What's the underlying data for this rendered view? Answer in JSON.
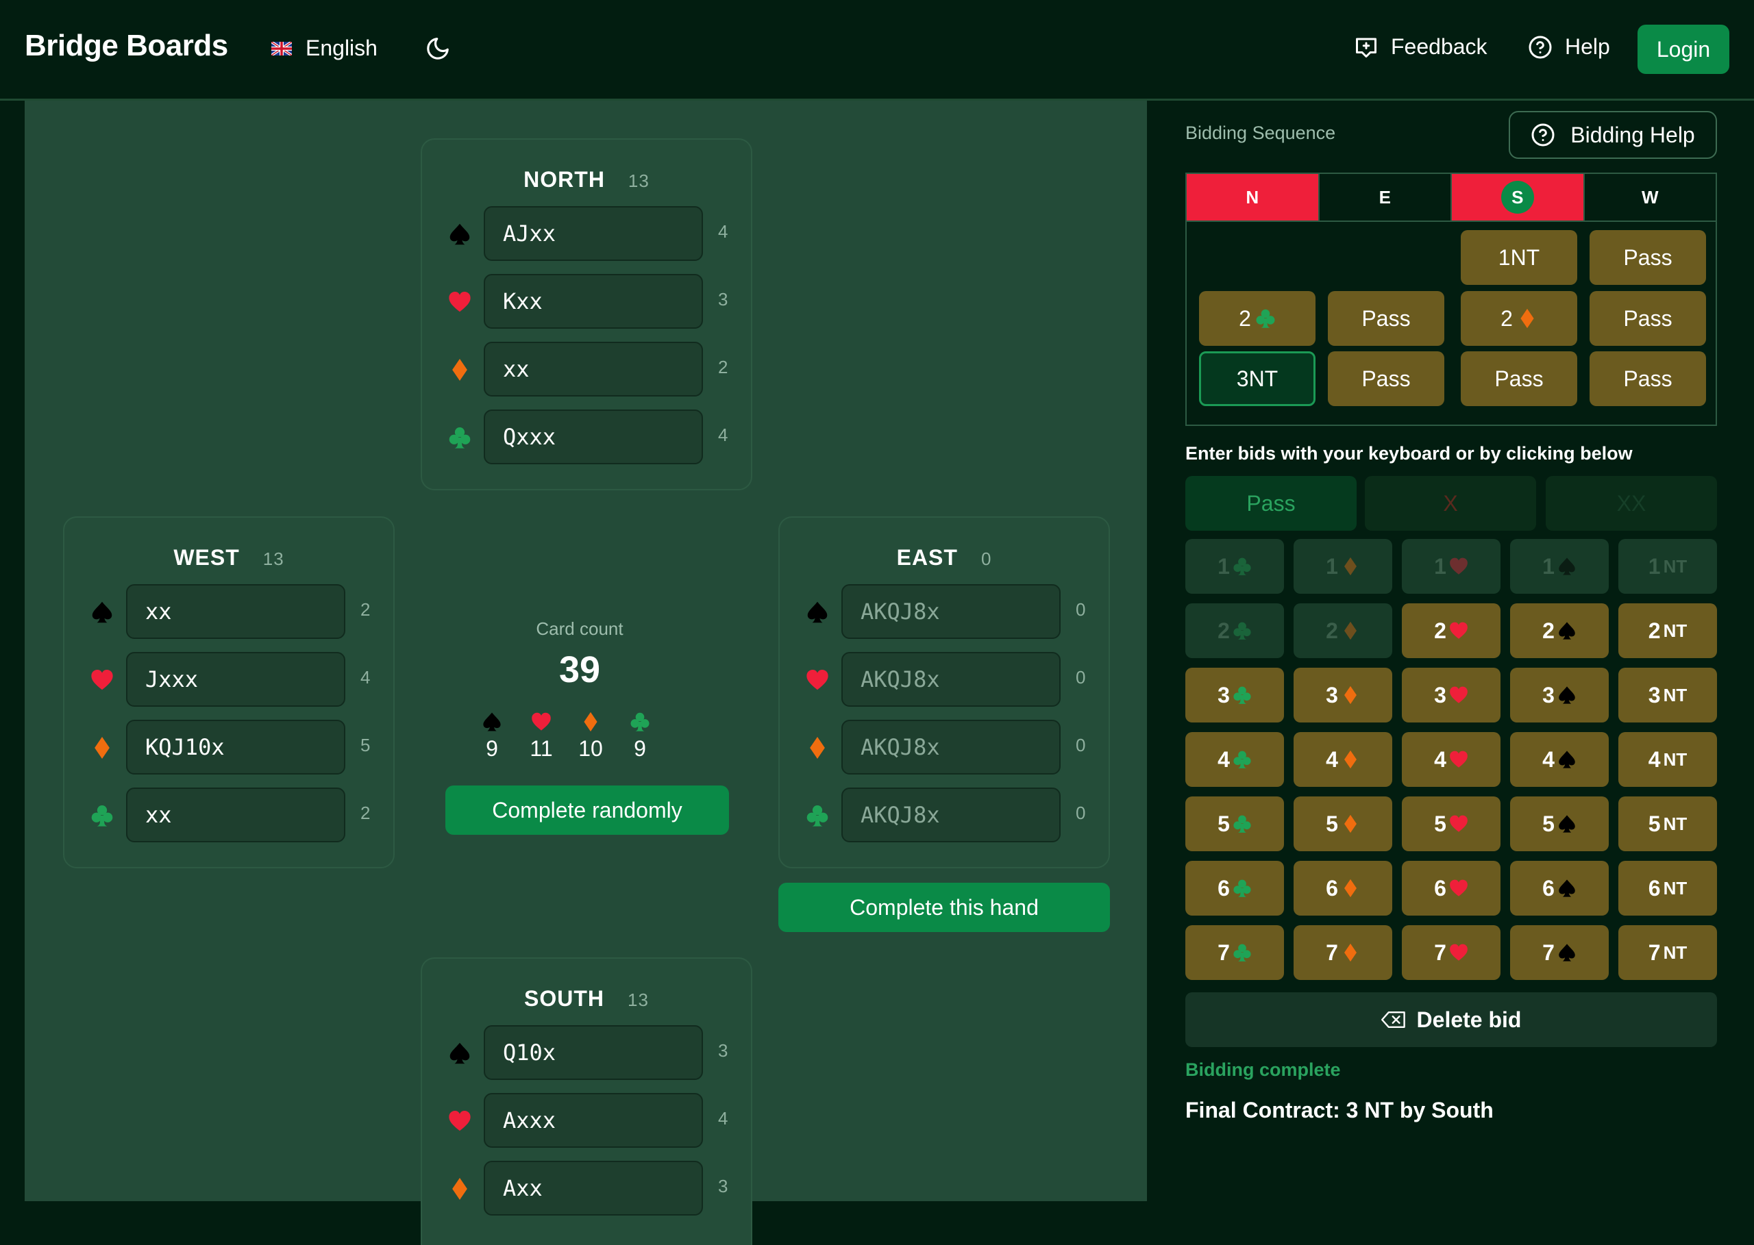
{
  "header": {
    "brand": "Bridge Boards",
    "language": "English",
    "feedback_label": "Feedback",
    "help_label": "Help",
    "login_label": "Login"
  },
  "hands": {
    "north": {
      "label": "NORTH",
      "count": "13",
      "suits": [
        {
          "suit": "spade",
          "cards": "AJxx",
          "len": "4"
        },
        {
          "suit": "heart",
          "cards": "Kxx",
          "len": "3"
        },
        {
          "suit": "diamond",
          "cards": "xx",
          "len": "2"
        },
        {
          "suit": "club",
          "cards": "Qxxx",
          "len": "4"
        }
      ]
    },
    "west": {
      "label": "WEST",
      "count": "13",
      "suits": [
        {
          "suit": "spade",
          "cards": "xx",
          "len": "2"
        },
        {
          "suit": "heart",
          "cards": "Jxxx",
          "len": "4"
        },
        {
          "suit": "diamond",
          "cards": "KQJ10x",
          "len": "5"
        },
        {
          "suit": "club",
          "cards": "xx",
          "len": "2"
        }
      ]
    },
    "east": {
      "label": "EAST",
      "count": "0",
      "placeholder": "AKQJ8x",
      "suits": [
        {
          "suit": "spade",
          "len": "0"
        },
        {
          "suit": "heart",
          "len": "0"
        },
        {
          "suit": "diamond",
          "len": "0"
        },
        {
          "suit": "club",
          "len": "0"
        }
      ]
    },
    "south": {
      "label": "SOUTH",
      "count": "13",
      "suits": [
        {
          "suit": "spade",
          "cards": "Q10x",
          "len": "3"
        },
        {
          "suit": "heart",
          "cards": "Axxx",
          "len": "4"
        },
        {
          "suit": "diamond",
          "cards": "Axx",
          "len": "3"
        }
      ]
    }
  },
  "card_count": {
    "label": "Card count",
    "total": "39",
    "per_suit": [
      "9",
      "11",
      "10",
      "9"
    ]
  },
  "buttons": {
    "complete_randomly": "Complete randomly",
    "complete_hand": "Complete this hand"
  },
  "bidding": {
    "title": "Bidding Sequence",
    "help_label": "Bidding Help",
    "seats": [
      "N",
      "E",
      "S",
      "W"
    ],
    "auction": [
      "1NT",
      "Pass",
      "2",
      "Pass",
      "2",
      "Pass",
      "3NT",
      "Pass",
      "Pass",
      "Pass"
    ],
    "enter_label": "Enter bids with your keyboard or by clicking below",
    "pass_label": "Pass",
    "double_label": "X",
    "redouble_label": "XX",
    "nt_label": "NT",
    "delete_label": "Delete bid",
    "status": "Bidding complete",
    "final_contract": "Final Contract: 3 NT by South"
  },
  "colors": {
    "spade": "#000000",
    "heart": "#ef1f3a",
    "diamond": "#f06d0f",
    "club": "#1fa356",
    "accent": "#0a8a47",
    "bid": "#6b5b1f"
  }
}
